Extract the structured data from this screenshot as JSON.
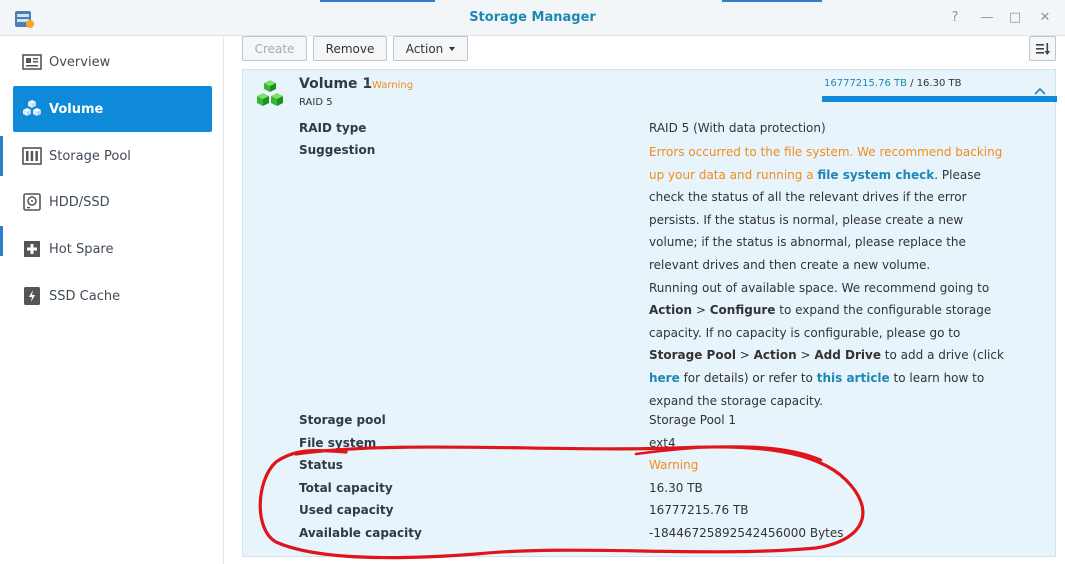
{
  "window": {
    "title": "Storage Manager"
  },
  "sidebar": {
    "items": [
      {
        "label": "Overview",
        "icon": "overview-icon"
      },
      {
        "label": "Volume",
        "icon": "volume-icon"
      },
      {
        "label": "Storage Pool",
        "icon": "storage-pool-icon"
      },
      {
        "label": "HDD/SSD",
        "icon": "hdd-icon"
      },
      {
        "label": "Hot Spare",
        "icon": "hot-spare-icon"
      },
      {
        "label": "SSD Cache",
        "icon": "ssd-cache-icon"
      }
    ],
    "active": "Volume"
  },
  "toolbar": {
    "create_label": "Create",
    "remove_label": "Remove",
    "action_label": "Action"
  },
  "volume": {
    "name": "Volume 1",
    "dash": "-",
    "status_badge": "Warning",
    "raid_short": "RAID 5",
    "usage_used": "16777215.76 TB",
    "usage_sep": " / ",
    "usage_total": "16.30 TB"
  },
  "details": {
    "raid_type_label": "RAID type",
    "raid_type_value": "RAID 5 (With data protection)",
    "suggestion_label": "Suggestion",
    "suggestion": {
      "p1_warn": "Errors occurred to the file system. We recommend backing up your data and running a",
      "p1_link": "file system check",
      "p1_rest": ". Please check the status of all the relevant drives if the error persists. If the status is normal, please create a new volume; if the status is abnormal, please replace the relevant drives and then create a new volume.",
      "p2_a": "Running out of available space. We recommend going to",
      "p2_b1": "Action",
      "p2_gt1": " > ",
      "p2_b2": "Configure",
      "p2_c": " to expand the configurable storage capacity. If no capacity is configurable, please go to",
      "p2_b3": "Storage Pool",
      "p2_gt2": " > ",
      "p2_b4": "Action",
      "p2_gt3": " > ",
      "p2_b5": "Add Drive",
      "p2_d": " to add a drive (click",
      "p2_link1": "here",
      "p2_e": " for details) or refer to",
      "p2_link2": "this article",
      "p2_f": " to learn how to expand the storage capacity."
    },
    "storage_pool_label": "Storage pool",
    "storage_pool_value": "Storage Pool 1",
    "file_system_label": "File system",
    "file_system_value": "ext4",
    "status_label": "Status",
    "status_value": "Warning",
    "total_capacity_label": "Total capacity",
    "total_capacity_value": "16.30 TB",
    "used_capacity_label": "Used capacity",
    "used_capacity_value": "16777215.76 TB",
    "available_capacity_label": "Available capacity",
    "available_capacity_value": "-18446725892542456000 Bytes"
  },
  "colors": {
    "accent": "#0e8ad8",
    "title": "#1f87b4",
    "warning": "#f28b1c",
    "panel_bg": "#e8f4fb",
    "annotation": "#e0141b"
  }
}
